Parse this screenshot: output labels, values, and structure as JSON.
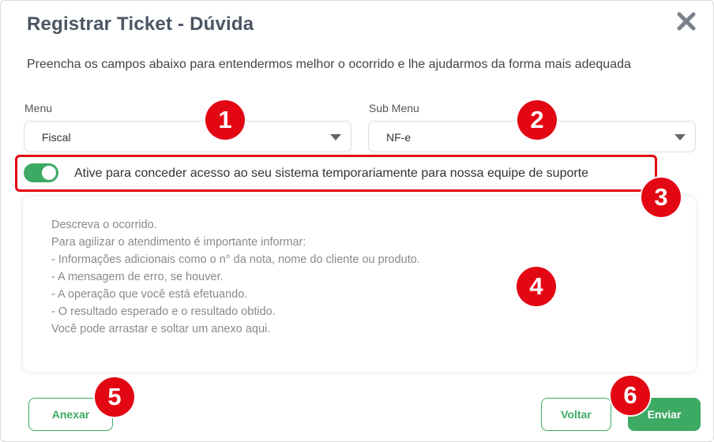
{
  "dialog": {
    "title": "Registrar Ticket - Dúvida",
    "subtitle": "Preencha os campos abaixo para entendermos melhor o ocorrido e lhe ajudarmos da forma mais adequada",
    "close_icon": "close-icon"
  },
  "menu": {
    "label": "Menu",
    "value": "Fiscal"
  },
  "submenu": {
    "label": "Sub Menu",
    "value": "NF-e"
  },
  "access_toggle": {
    "label": "Ative para conceder acesso ao seu sistema temporariamente para nossa equipe de suporte",
    "enabled": true
  },
  "description": {
    "placeholder_lines": [
      "Descreva o ocorrido.",
      "Para agilizar o atendimento é importante informar:",
      "- Informações adicionais como o n° da nota, nome do cliente ou produto.",
      "- A mensagem de erro, se houver.",
      "- A operação que você está efetuando.",
      "- O resultado esperado e o resultado obtido.",
      "Você pode arrastar e soltar um anexo aqui."
    ]
  },
  "buttons": {
    "attach": "Anexar",
    "back": "Voltar",
    "send": "Enviar"
  },
  "annotations": [
    "1",
    "2",
    "3",
    "4",
    "5",
    "6"
  ],
  "colors": {
    "accent": "#3daa63",
    "annotation": "#e30613",
    "title": "#4b5563"
  }
}
